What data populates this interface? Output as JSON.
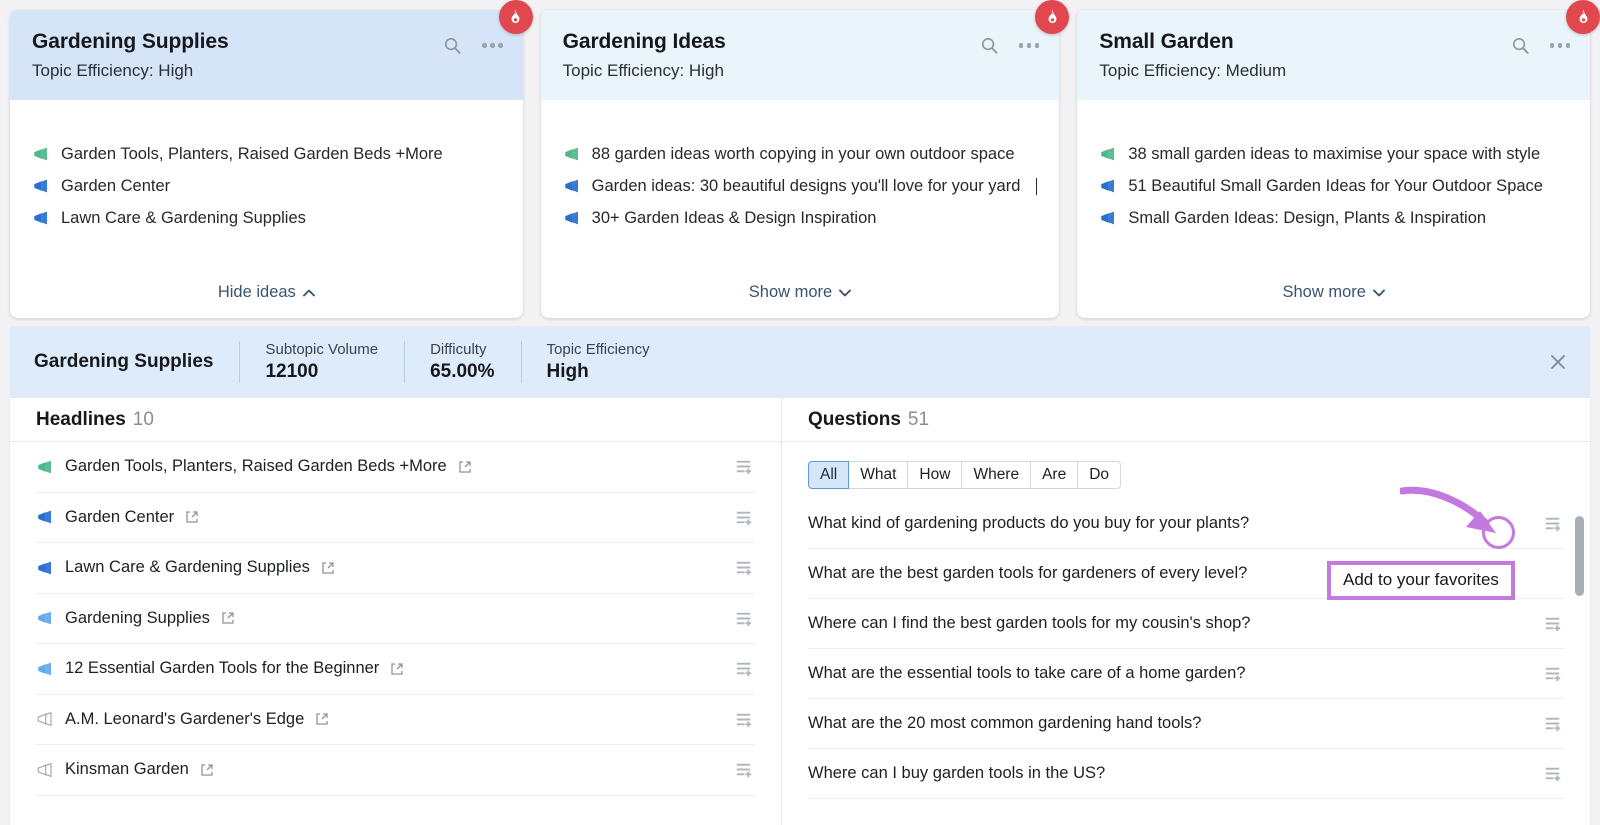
{
  "colors": {
    "accent_blue": "#3a5470",
    "header_strong": "#d5e4f7",
    "header_light": "#e9f4fb",
    "metrics_bg": "#ddebfb",
    "flame_red": "#e1474f",
    "annotation_purple": "#c479df",
    "pill_active_bg": "#d6e6f8"
  },
  "cards": [
    {
      "title": "Gardening Supplies",
      "subtitle": "Topic Efficiency: High",
      "header_variant": "strong",
      "badge_icon": "flame-icon",
      "search_icon": "search-icon",
      "menu_icon": "more-options-icon",
      "ideas": [
        {
          "text": "Garden Tools, Planters, Raised Garden Beds +More",
          "icon": "megaphone-icon",
          "icon_color": "green",
          "caret": false
        },
        {
          "text": "Garden Center",
          "icon": "megaphone-icon",
          "icon_color": "blue",
          "caret": false
        },
        {
          "text": "Lawn Care & Gardening Supplies",
          "icon": "megaphone-icon",
          "icon_color": "blue",
          "caret": false
        }
      ],
      "toggle_label": "Hide ideas",
      "toggle_direction": "up"
    },
    {
      "title": "Gardening Ideas",
      "subtitle": "Topic Efficiency: High",
      "header_variant": "light",
      "badge_icon": "flame-icon",
      "search_icon": "search-icon",
      "menu_icon": "more-options-icon",
      "ideas": [
        {
          "text": "88 garden ideas worth copying in your own outdoor space",
          "icon": "megaphone-icon",
          "icon_color": "green",
          "caret": false
        },
        {
          "text": "Garden ideas: 30 beautiful designs you'll love for your yard",
          "icon": "megaphone-icon",
          "icon_color": "blue",
          "caret": true
        },
        {
          "text": "30+ Garden Ideas & Design Inspiration",
          "icon": "megaphone-icon",
          "icon_color": "blue",
          "caret": false
        }
      ],
      "toggle_label": "Show more",
      "toggle_direction": "down"
    },
    {
      "title": "Small Garden",
      "subtitle": "Topic Efficiency: Medium",
      "header_variant": "light",
      "badge_icon": "flame-icon",
      "search_icon": "search-icon",
      "menu_icon": "more-options-icon",
      "ideas": [
        {
          "text": "38 small garden ideas to maximise your space with style",
          "icon": "megaphone-icon",
          "icon_color": "green",
          "caret": false
        },
        {
          "text": "51 Beautiful Small Garden Ideas for Your Outdoor Space",
          "icon": "megaphone-icon",
          "icon_color": "blue",
          "caret": false
        },
        {
          "text": "Small Garden Ideas: Design, Plants & Inspiration",
          "icon": "megaphone-icon",
          "icon_color": "blue",
          "caret": false
        }
      ],
      "toggle_label": "Show more",
      "toggle_direction": "down"
    }
  ],
  "metrics_bar": {
    "topic": "Gardening Supplies",
    "items": [
      {
        "label": "Subtopic Volume",
        "value": "12100"
      },
      {
        "label": "Difficulty",
        "value": "65.00%"
      },
      {
        "label": "Topic Efficiency",
        "value": "High"
      }
    ],
    "close_icon": "close-icon"
  },
  "headlines_panel": {
    "title": "Headlines",
    "count": "10",
    "rows": [
      {
        "text": "Garden Tools, Planters, Raised Garden Beds +More",
        "icon_color": "green",
        "link_icon": "external-link-icon",
        "add_icon": "add-to-list-icon"
      },
      {
        "text": "Garden Center",
        "icon_color": "blue",
        "link_icon": "external-link-icon",
        "add_icon": "add-to-list-icon"
      },
      {
        "text": "Lawn Care & Gardening Supplies",
        "icon_color": "blue",
        "link_icon": "external-link-icon",
        "add_icon": "add-to-list-icon"
      },
      {
        "text": "Gardening Supplies",
        "icon_color": "lightblue",
        "link_icon": "external-link-icon",
        "add_icon": "add-to-list-icon"
      },
      {
        "text": "12 Essential Garden Tools for the Beginner",
        "icon_color": "lightblue",
        "link_icon": "external-link-icon",
        "add_icon": "add-to-list-icon"
      },
      {
        "text": "A.M. Leonard's Gardener's Edge",
        "icon_color": "gray",
        "link_icon": "external-link-icon",
        "add_icon": "add-to-list-icon"
      },
      {
        "text": "Kinsman Garden",
        "icon_color": "gray",
        "link_icon": "external-link-icon",
        "add_icon": "add-to-list-icon"
      }
    ]
  },
  "questions_panel": {
    "title": "Questions",
    "count": "51",
    "filters": [
      {
        "label": "All",
        "active": true
      },
      {
        "label": "What",
        "active": false
      },
      {
        "label": "How",
        "active": false
      },
      {
        "label": "Where",
        "active": false
      },
      {
        "label": "Are",
        "active": false
      },
      {
        "label": "Do",
        "active": false
      }
    ],
    "rows": [
      {
        "text": "What kind of gardening products do you buy for your plants?",
        "add_icon": "add-to-list-icon"
      },
      {
        "text": "What are the best garden tools for gardeners of every level?",
        "add_icon": "add-to-list-icon"
      },
      {
        "text": "Where can I find the best garden tools for my cousin's shop?",
        "add_icon": "add-to-list-icon"
      },
      {
        "text": "What are the essential tools to take care of a home garden?",
        "add_icon": "add-to-list-icon"
      },
      {
        "text": "What are the 20 most common gardening hand tools?",
        "add_icon": "add-to-list-icon"
      },
      {
        "text": "Where can I buy garden tools in the US?",
        "add_icon": "add-to-list-icon"
      }
    ]
  },
  "annotation": {
    "tooltip_text": "Add to your favorites",
    "arrow_icon": "curved-arrow-annotation",
    "highlight_icon": "circle-highlight-annotation"
  }
}
